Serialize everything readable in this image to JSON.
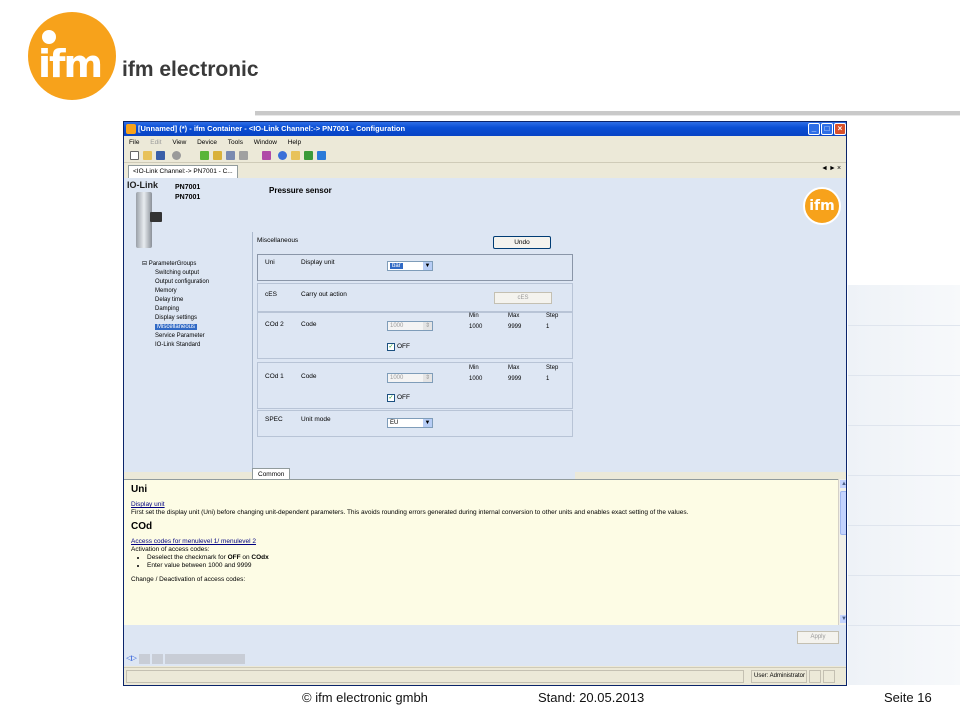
{
  "brand": {
    "logo_text": "ifm",
    "name": "ifm electronic"
  },
  "window": {
    "title": "[Unnamed] (*) - ifm Container - <IO-Link Channel:-> PN7001 - Configuration",
    "controls": {
      "minimize": "_",
      "maximize": "□",
      "close": "×"
    }
  },
  "menu": [
    "File",
    "Edit",
    "View",
    "Device",
    "Tools",
    "Window",
    "Help"
  ],
  "doc_tab": {
    "label": "<IO-Link Channel:-> PN7001 - C..."
  },
  "tab_nav": {
    "left": "◄",
    "right": "►",
    "close": "×"
  },
  "device": {
    "iolink": "IO-Link",
    "name1": "PN7001",
    "name2": "PN7001",
    "title": "Pressure sensor"
  },
  "tree": {
    "root": "ParameterGroups",
    "items": [
      "Switching output",
      "Output configuration",
      "Memory",
      "Delay time",
      "Damping",
      "Display settings",
      "Miscellaneous",
      "Service Parameter",
      "IO-Link Standard"
    ],
    "selected_index": 6
  },
  "panel": {
    "section": "Miscellaneous",
    "undo": "Undo",
    "params": {
      "uni": {
        "code": "Uni",
        "name": "Display unit",
        "value": "bar"
      },
      "ces": {
        "code": "cES",
        "name": "Carry out action",
        "button": "cES"
      },
      "cod2": {
        "code": "COd 2",
        "name": "Code",
        "value": "1000",
        "min_h": "Min",
        "max_h": "Max",
        "step_h": "Step",
        "min": "1000",
        "max": "9999",
        "step": "1",
        "check": "OFF"
      },
      "cod1": {
        "code": "COd 1",
        "name": "Code",
        "value": "1000",
        "min_h": "Min",
        "max_h": "Max",
        "step_h": "Step",
        "min": "1000",
        "max": "9999",
        "step": "1",
        "check": "OFF"
      },
      "spec": {
        "code": "SPEC",
        "name": "Unit mode",
        "value": "EU"
      }
    }
  },
  "common_tab": "Common",
  "help": {
    "h1": "Uni",
    "link1": "Display unit",
    "text1": "First set the display unit (Uni) before changing unit-dependent parameters. This avoids rounding errors generated during internal conversion to other units and enables exact setting of the values.",
    "h2": "COd",
    "link2": "Access codes for menulevel 1/ menulevel 2",
    "text2": "Activation of access codes:",
    "bullet1_a": "Deselect the checkmark for ",
    "bullet1_b": "OFF",
    "bullet1_c": " on ",
    "bullet1_d": "COdx",
    "bullet2": "Enter value between 1000 and 9999",
    "text3": "Change / Deactivation of access codes:"
  },
  "apply": "Apply",
  "status": {
    "user": "User: Administrator"
  },
  "footer": {
    "copyright": "© ifm electronic gmbh",
    "date": "Stand: 20.05.2013",
    "page": "Seite 16"
  },
  "colors": {
    "ifm_orange": "#f7a21b",
    "xp_blue": "#0a4ed4",
    "panel_bg": "#dde6f3",
    "help_bg": "#fdfce5"
  }
}
